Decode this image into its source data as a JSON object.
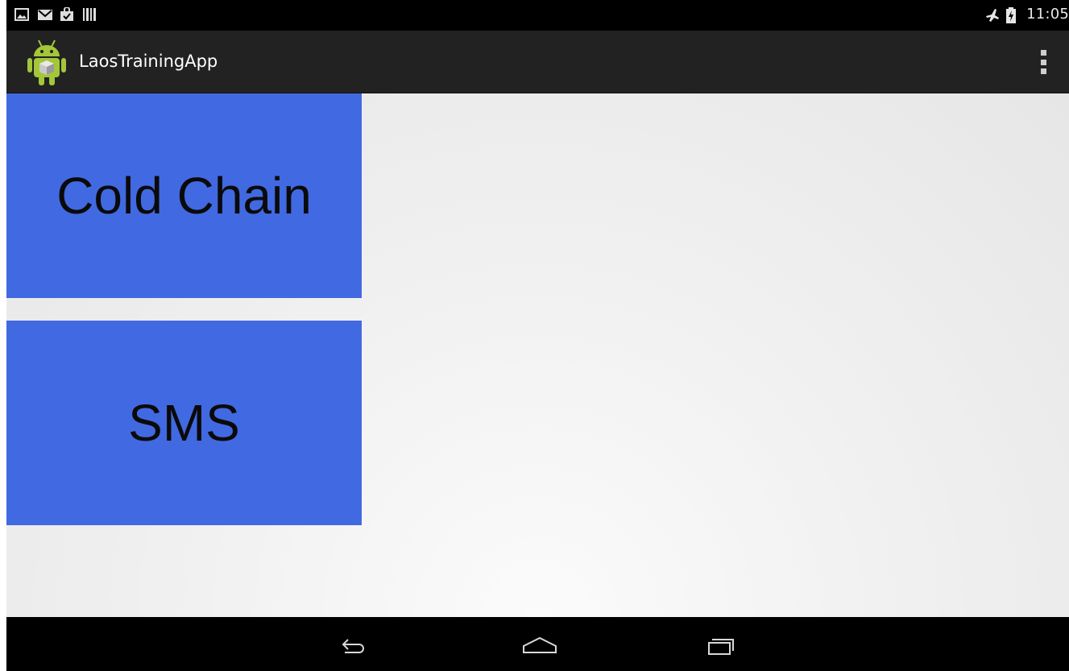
{
  "status_bar": {
    "left_icons": [
      "picture-icon",
      "gmail-icon",
      "shopping-bag-icon",
      "barcode-icon"
    ],
    "right_icons": [
      "airplane-mode-icon",
      "battery-charging-icon"
    ],
    "time": "11:05"
  },
  "action_bar": {
    "app_icon": "android-app-icon",
    "title": "LaosTrainingApp",
    "overflow_icon": "overflow-menu-icon"
  },
  "main": {
    "tiles": [
      {
        "label": "Cold Chain"
      },
      {
        "label": "SMS"
      }
    ],
    "tile_color": "#4169e1"
  },
  "nav_bar": {
    "icons": [
      "back-icon",
      "home-icon",
      "recents-icon"
    ]
  }
}
